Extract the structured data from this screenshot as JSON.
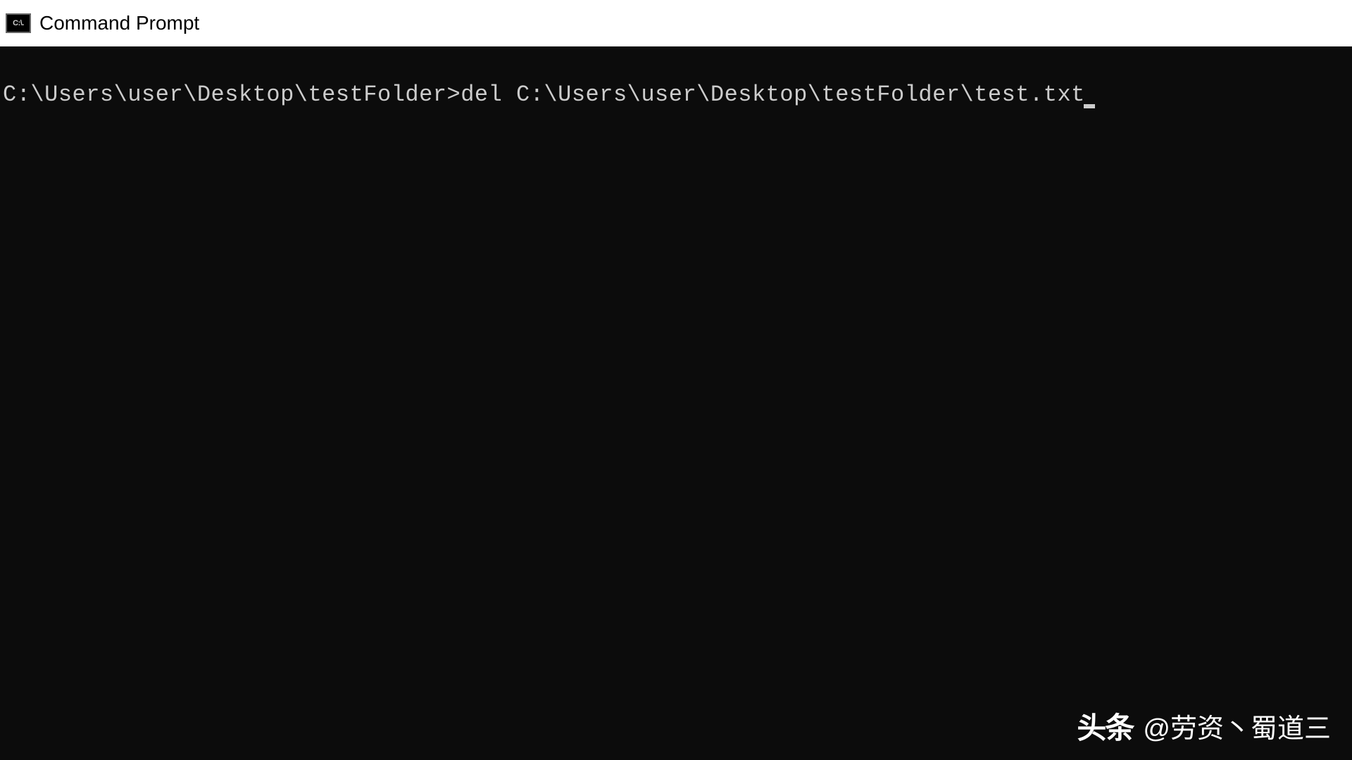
{
  "window": {
    "title": "Command Prompt",
    "icon_label": "C:\\."
  },
  "terminal": {
    "prompt": "C:\\Users\\user\\Desktop\\testFolder>",
    "command": "del C:\\Users\\user\\Desktop\\testFolder\\test.txt"
  },
  "watermark": {
    "logo_text": "头条",
    "author": "@劳资丶蜀道三"
  }
}
